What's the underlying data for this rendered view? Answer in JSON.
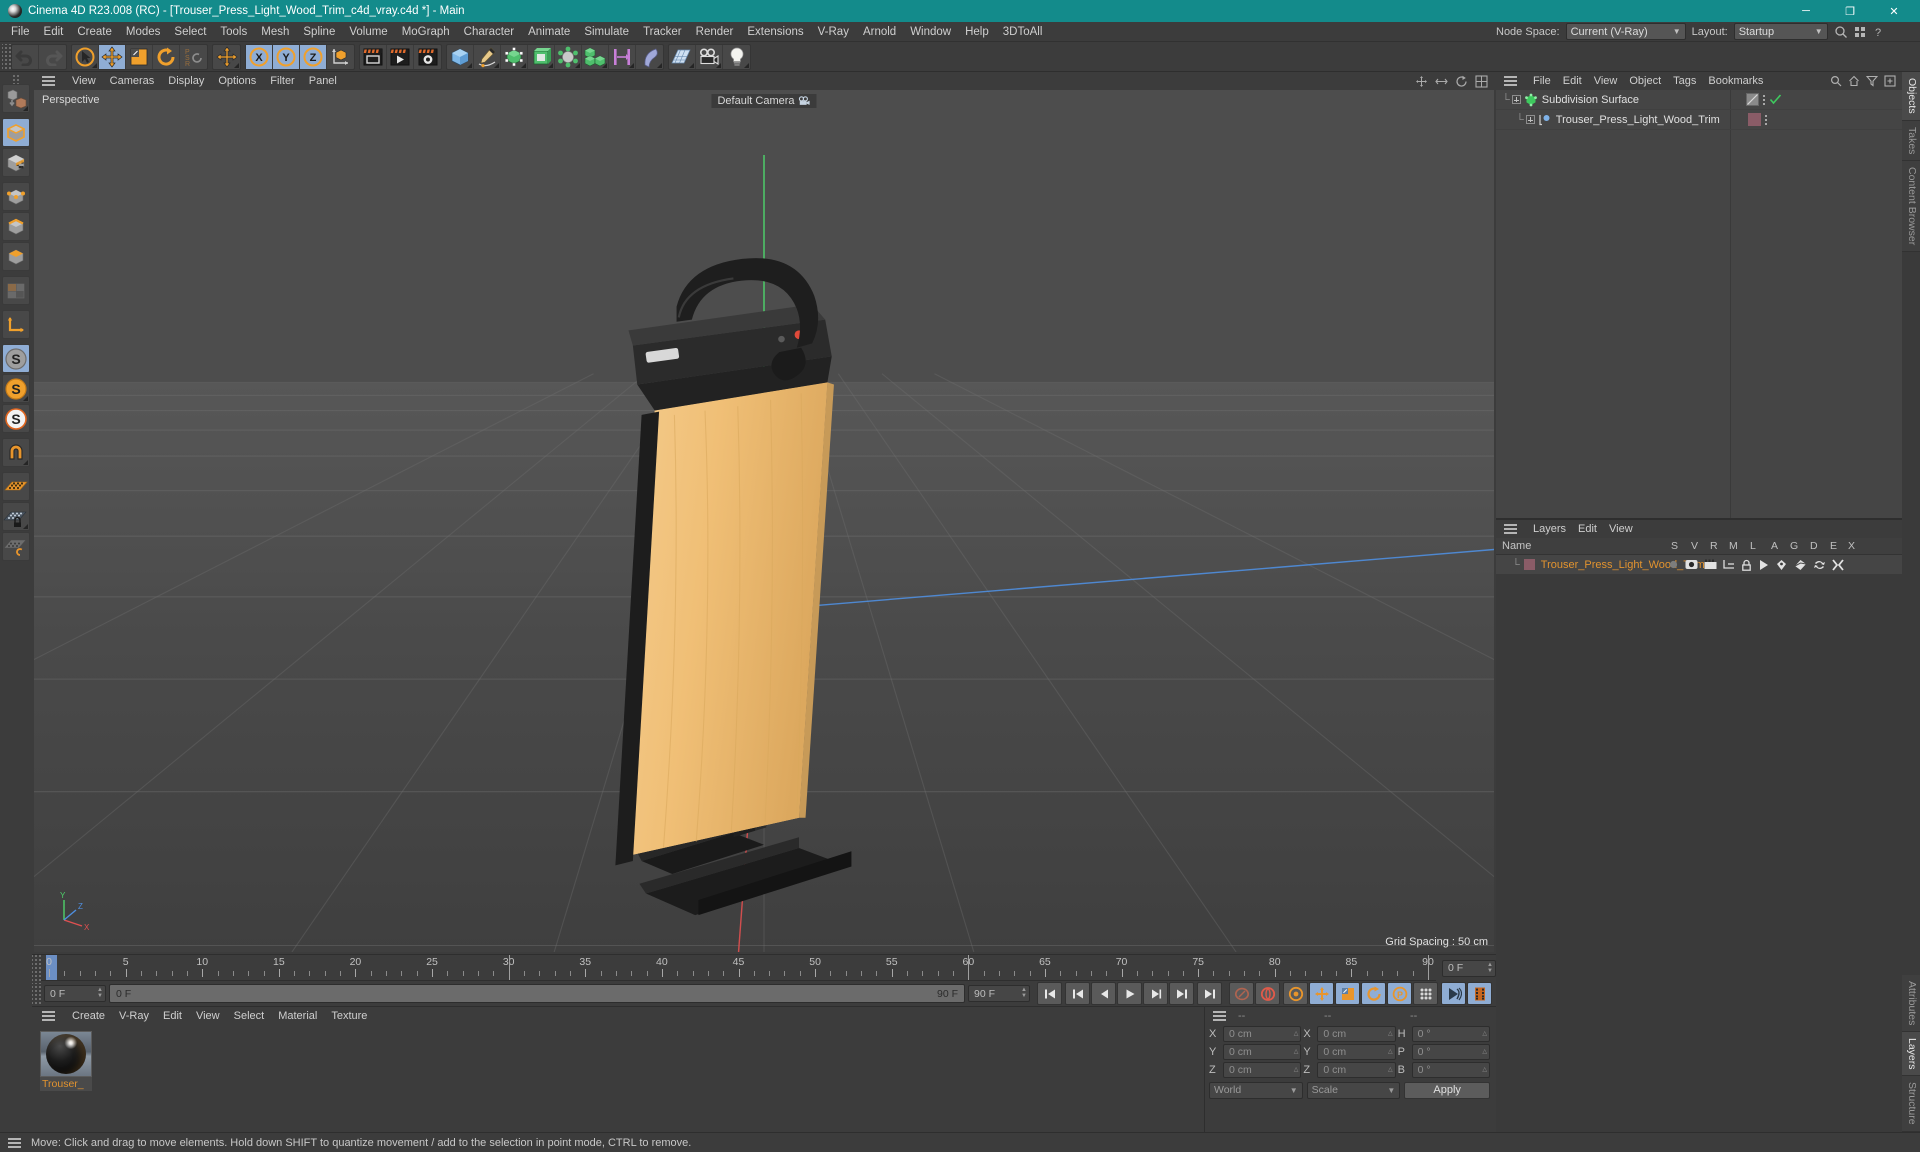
{
  "titlebar": {
    "title": "Cinema 4D R23.008 (RC) - [Trouser_Press_Light_Wood_Trim_c4d_vray.c4d *] - Main",
    "minimize": "─",
    "maximize": "❐",
    "close": "✕",
    "logo_icon": "c4d-logo-icon"
  },
  "menubar": {
    "items": [
      "File",
      "Edit",
      "Create",
      "Modes",
      "Select",
      "Tools",
      "Mesh",
      "Spline",
      "Volume",
      "MoGraph",
      "Character",
      "Animate",
      "Simulate",
      "Tracker",
      "Render",
      "Extensions",
      "V-Ray",
      "Arnold",
      "Window",
      "Help",
      "3DToAll"
    ],
    "node_space_label": "Node Space:",
    "node_space_value": "Current (V-Ray)",
    "layout_label": "Layout:",
    "layout_value": "Startup"
  },
  "toolbar": {
    "groups": [
      {
        "buttons": [
          {
            "name": "undo-button",
            "icon": "undo-icon",
            "active": false
          },
          {
            "name": "redo-button",
            "icon": "redo-icon",
            "active": false
          }
        ]
      },
      {
        "buttons": [
          {
            "name": "select-tool-button",
            "icon": "live-selection-icon",
            "active": false,
            "corner": true
          },
          {
            "name": "move-tool-button",
            "icon": "move-icon",
            "active": true
          },
          {
            "name": "scale-tool-button",
            "icon": "scale-icon",
            "active": false
          },
          {
            "name": "rotate-tool-button",
            "icon": "rotate-icon",
            "active": false
          },
          {
            "name": "psr-button",
            "icon": "psr-icon",
            "active": false
          }
        ]
      },
      {
        "buttons": [
          {
            "name": "axis-move-button",
            "icon": "move-axis-icon",
            "active": false,
            "corner": true
          }
        ]
      },
      {
        "buttons": [
          {
            "name": "x-axis-lock-button",
            "icon": "x-axis-icon",
            "active": true
          },
          {
            "name": "y-axis-lock-button",
            "icon": "y-axis-icon",
            "active": true
          },
          {
            "name": "z-axis-lock-button",
            "icon": "z-axis-icon",
            "active": true
          },
          {
            "name": "world-coordinates-button",
            "icon": "world-object-axis-icon",
            "active": false
          }
        ]
      },
      {
        "buttons": [
          {
            "name": "render-view-button",
            "icon": "render-view-icon",
            "active": false
          },
          {
            "name": "render-to-picture-viewer-button",
            "icon": "render-picture-viewer-icon",
            "active": false
          },
          {
            "name": "render-settings-button",
            "icon": "render-settings-icon",
            "active": false
          }
        ]
      },
      {
        "buttons": [
          {
            "name": "add-cube-button",
            "icon": "cube-icon",
            "active": false,
            "corner": true
          },
          {
            "name": "add-spline-button",
            "icon": "pen-spline-icon",
            "active": false,
            "corner": true
          },
          {
            "name": "add-nurbs-button",
            "icon": "subdivision-surface-icon",
            "active": false,
            "corner": true
          },
          {
            "name": "add-generator-button",
            "icon": "array-generator-icon",
            "active": false,
            "corner": true
          },
          {
            "name": "add-deformer-button",
            "icon": "bend-deformer-icon",
            "active": false,
            "corner": true
          },
          {
            "name": "add-mograph-button",
            "icon": "cloner-icon",
            "active": false,
            "corner": true
          },
          {
            "name": "add-field-button",
            "icon": "field-icon",
            "active": false,
            "corner": true
          },
          {
            "name": "add-bend-button",
            "icon": "bend-icon",
            "active": false,
            "corner": true
          }
        ]
      },
      {
        "buttons": [
          {
            "name": "add-floor-button",
            "icon": "floor-icon",
            "active": false,
            "corner": true
          },
          {
            "name": "add-camera-button",
            "icon": "camera-icon",
            "active": false,
            "corner": true
          },
          {
            "name": "add-light-button",
            "icon": "light-bulb-icon",
            "active": false,
            "corner": true
          }
        ]
      }
    ]
  },
  "left_palette": {
    "buttons": [
      {
        "name": "make-editable-button",
        "icon": "make-editable-icon",
        "active": false,
        "corner": true,
        "group_end": true
      },
      {
        "name": "model-mode-button",
        "icon": "model-mode-icon",
        "active": true
      },
      {
        "name": "texture-mode-button",
        "icon": "texture-mode-icon",
        "active": false,
        "group_end": true
      },
      {
        "name": "points-mode-button",
        "icon": "points-mode-icon",
        "active": false
      },
      {
        "name": "edges-mode-button",
        "icon": "edges-mode-icon",
        "active": false
      },
      {
        "name": "polygons-mode-button",
        "icon": "polygons-mode-icon",
        "active": false,
        "group_end": true
      },
      {
        "name": "uv-mode-button",
        "icon": "uv-polygon-icon",
        "active": false,
        "group_end": true
      },
      {
        "name": "axis-mode-button",
        "icon": "object-axis-icon",
        "active": false,
        "group_end": true
      },
      {
        "name": "viewport-solo-off-button",
        "icon": "solo-off-icon",
        "active": true
      },
      {
        "name": "viewport-solo-single-button",
        "icon": "solo-single-icon",
        "active": false,
        "corner": true
      },
      {
        "name": "viewport-solo-hierarchy-button",
        "icon": "solo-hierarchy-icon",
        "active": false,
        "group_end": true
      },
      {
        "name": "snap-toggle-button",
        "icon": "magnet-snap-icon",
        "active": false,
        "corner": true,
        "group_end": true
      },
      {
        "name": "workplane-button",
        "icon": "workplane-icon",
        "active": false
      },
      {
        "name": "lock-workplane-button",
        "icon": "lock-workplane-icon",
        "active": true,
        "corner": true
      },
      {
        "name": "planar-workplane-button",
        "icon": "planar-workplane-icon",
        "active": false
      }
    ]
  },
  "viewport": {
    "menu": [
      "View",
      "Cameras",
      "Display",
      "Options",
      "Filter",
      "Panel"
    ],
    "label": "Perspective",
    "camera_label": "Default Camera",
    "camera_icon": "camera-icon",
    "grid_spacing": "Grid Spacing : 50 cm",
    "axis_labels": {
      "x": "X",
      "y": "Y",
      "z": "Z"
    },
    "header_icons": [
      "pan-view-icon",
      "zoom-view-icon",
      "rotate-view-icon",
      "maximize-view-icon"
    ],
    "scene_object": "Trouser Press Light Wood Trim"
  },
  "timeline": {
    "start_frame": "0 F",
    "preview_start": "0 F",
    "preview_end": "90 F",
    "end_frame": "90 F",
    "current_frame": "0 F",
    "ticks": [
      0,
      5,
      10,
      15,
      20,
      25,
      30,
      35,
      40,
      45,
      50,
      55,
      60,
      65,
      70,
      75,
      80,
      85,
      90
    ],
    "playhead_frame": 0,
    "transport": [
      {
        "name": "go-to-start-button",
        "icon": "go-to-start-icon"
      },
      {
        "name": "previous-key-button",
        "icon": "previous-key-icon"
      },
      {
        "name": "step-back-button",
        "icon": "step-back-icon"
      },
      {
        "name": "play-button",
        "icon": "play-icon"
      },
      {
        "name": "step-forward-button",
        "icon": "step-forward-icon"
      },
      {
        "name": "next-key-button",
        "icon": "next-key-icon"
      },
      {
        "name": "go-to-end-button",
        "icon": "go-to-end-icon"
      }
    ],
    "record_buttons": [
      {
        "name": "autokey-button",
        "icon": "autokey-icon",
        "active": false
      },
      {
        "name": "record-button",
        "icon": "record-keyframe-icon",
        "active": false
      },
      {
        "name": "keyframe-settings-button",
        "icon": "keyframe-selection-icon",
        "active": false
      },
      {
        "name": "record-position-button",
        "icon": "position-key-icon",
        "active": true
      },
      {
        "name": "record-scale-button",
        "icon": "scale-key-icon",
        "active": true
      },
      {
        "name": "record-rotation-button",
        "icon": "rotation-key-icon",
        "active": true
      },
      {
        "name": "record-parameter-button",
        "icon": "parameter-key-icon",
        "active": true
      },
      {
        "name": "record-pla-button",
        "icon": "point-level-animation-icon",
        "active": false
      },
      {
        "name": "simulation-button",
        "icon": "simulation-icon",
        "active": true
      },
      {
        "name": "timeline-button",
        "icon": "timeline-filmstrip-icon",
        "active": true
      }
    ]
  },
  "material_manager": {
    "menu": [
      "Create",
      "V-Ray",
      "Edit",
      "View",
      "Select",
      "Material",
      "Texture"
    ],
    "materials": [
      {
        "name": "Trouser_",
        "preview": "black-glossy-sphere"
      }
    ]
  },
  "coordinates": {
    "header": [
      "--",
      "--",
      "--"
    ],
    "rows": [
      {
        "label1": "X",
        "value1": "0 cm",
        "label2": "X",
        "value2": "0 cm",
        "label3": "H",
        "value3": "0 °"
      },
      {
        "label1": "Y",
        "value1": "0 cm",
        "label2": "Y",
        "value2": "0 cm",
        "label3": "P",
        "value3": "0 °"
      },
      {
        "label1": "Z",
        "value1": "0 cm",
        "label2": "Z",
        "value2": "0 cm",
        "label3": "B",
        "value3": "0 °"
      }
    ],
    "system": "World",
    "mode": "Scale",
    "apply": "Apply"
  },
  "object_manager": {
    "menu": [
      "File",
      "Edit",
      "View",
      "Object",
      "Tags",
      "Bookmarks"
    ],
    "header_icons": [
      "search-icon",
      "home-icon",
      "filter-icon",
      "add-panel-icon"
    ],
    "rows": [
      {
        "name": "Subdivision Surface",
        "icon": "subdivision-surface-icon",
        "depth": 0,
        "has_children": true,
        "tag_icon": "phong-tag-icon",
        "visible_check": true
      },
      {
        "name": "Trouser_Press_Light_Wood_Trim",
        "icon": "polygon-object-icon",
        "depth": 1,
        "has_children": true,
        "tag_icon": "layer-color-tag",
        "visible_check": false
      }
    ]
  },
  "layer_manager": {
    "menu": [
      "Layers",
      "Edit",
      "View"
    ],
    "columns": [
      "Name",
      "S",
      "V",
      "R",
      "M",
      "L",
      "A",
      "G",
      "D",
      "E",
      "X"
    ],
    "rows": [
      {
        "name": "Trouser_Press_Light_Wood_Trim",
        "color": "#8a5c67",
        "icons": [
          "solo-dot-icon",
          "visible-eye-icon",
          "render-icon",
          "manager-icon",
          "lock-icon",
          "animation-icon",
          "generator-icon",
          "deformer-icon",
          "expression-icon",
          "xpresso-icon"
        ]
      }
    ]
  },
  "right_tabs": {
    "top": [
      "Objects",
      "Takes",
      "Content Browser"
    ],
    "bottom": [
      "Attributes",
      "Layers",
      "Structure"
    ],
    "top_active": "Objects",
    "bottom_active": "Layers"
  },
  "status_bar": {
    "message": "Move: Click and drag to move elements. Hold down SHIFT to quantize movement / add to the selection in point mode, CTRL to remove."
  },
  "colors": {
    "title_bar": "#138b8b",
    "panel_bg": "#3c3c3c",
    "active_tool": "#8fadd4",
    "accent_orange": "#e2932f",
    "layer_color": "#8a5c67"
  }
}
